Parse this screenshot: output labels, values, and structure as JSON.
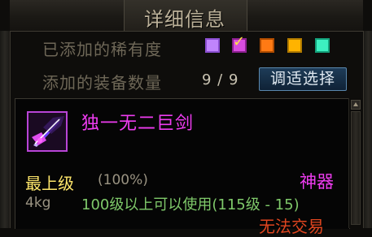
{
  "window": {
    "title": "详细信息"
  },
  "filters": {
    "rarity_label": "已添加的稀有度",
    "rarity_swatches": [
      {
        "color": "#c084fc",
        "checked": false
      },
      {
        "color": "#d94de0",
        "checked": true
      },
      {
        "color": "#ff7a14",
        "checked": false
      },
      {
        "color": "#ffb300",
        "checked": false
      },
      {
        "color": "#3df0c0",
        "checked": false
      }
    ],
    "check_glyph": "✓",
    "count_label": "添加的装备数量",
    "count_value": "9 / 9",
    "adjust_button": "调适选择"
  },
  "item": {
    "icon": "greatsword-icon",
    "name": "独一无二巨剑",
    "grade": "最上级",
    "grade_pct": "(100%)",
    "rarity": "神器",
    "weight": "4kg",
    "requirement": "100级以上可以使用(115级 - 15)",
    "trade": "无法交易",
    "colors": {
      "name": "#ee3cf0",
      "grade": "#ffe76b",
      "requirement": "#7fc96a",
      "trade": "#e0451f"
    }
  }
}
